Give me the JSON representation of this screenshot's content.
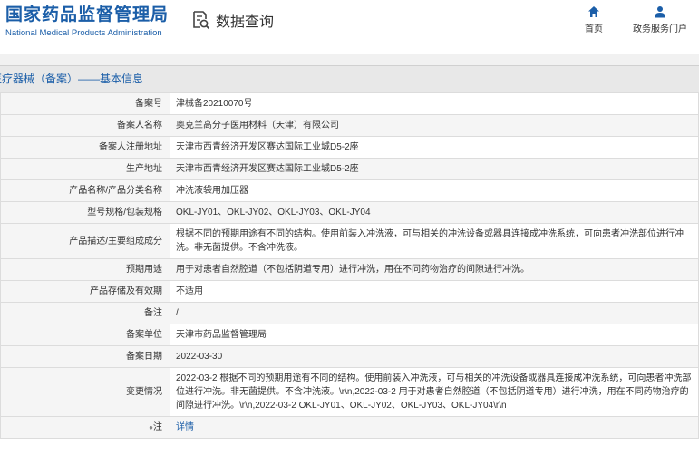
{
  "header": {
    "logo_cn": "国家药品监督管理局",
    "logo_en": "National Medical Products Administration",
    "data_query": "数据查询",
    "nav": [
      {
        "label": "首页",
        "icon": "home-icon"
      },
      {
        "label": "政务服务门户",
        "icon": "user-icon"
      }
    ]
  },
  "section": {
    "title": "医疗器械（备案）——基本信息"
  },
  "rows": [
    {
      "label": "备案号",
      "value": "津械备20210070号"
    },
    {
      "label": "备案人名称",
      "value": "奥克兰高分子医用材料（天津）有限公司"
    },
    {
      "label": "备案人注册地址",
      "value": "天津市西青经济开发区赛达国际工业城D5-2座"
    },
    {
      "label": "生产地址",
      "value": "天津市西青经济开发区赛达国际工业城D5-2座"
    },
    {
      "label": "产品名称/产品分类名称",
      "value": "冲洗液袋用加压器"
    },
    {
      "label": "型号规格/包装规格",
      "value": "OKL-JY01、OKL-JY02、OKL-JY03、OKL-JY04"
    },
    {
      "label": "产品描述/主要组成成分",
      "value": "根据不同的预期用途有不同的结构。使用前装入冲洗液，可与相关的冲洗设备或器具连接成冲洗系统，可向患者冲洗部位进行冲洗。非无菌提供。不含冲洗液。"
    },
    {
      "label": "预期用途",
      "value": "用于对患者自然腔道（不包括阴道专用）进行冲洗，用在不同药物治疗的间隙进行冲洗。"
    },
    {
      "label": "产品存储及有效期",
      "value": "不适用"
    },
    {
      "label": "备注",
      "value": "/"
    },
    {
      "label": "备案单位",
      "value": "天津市药品监督管理局"
    },
    {
      "label": "备案日期",
      "value": "2022-03-30"
    },
    {
      "label": "变更情况",
      "value": "2022-03-2 根据不同的预期用途有不同的结构。使用前装入冲洗液，可与相关的冲洗设备或器具连接成冲洗系统，可向患者冲洗部位进行冲洗。非无菌提供。不含冲洗液。\\r\\n,2022-03-2 用于对患者自然腔道（不包括阴道专用）进行冲洗，用在不同药物治疗的间隙进行冲洗。\\r\\n,2022-03-2 OKL-JY01、OKL-JY02、OKL-JY03、OKL-JY04\\r\\n"
    },
    {
      "label": "注",
      "value": "详情"
    }
  ],
  "colors": {
    "brand": "#1b5ea8",
    "label_bg": "#f5f5f5",
    "border": "#dcdcdc"
  }
}
